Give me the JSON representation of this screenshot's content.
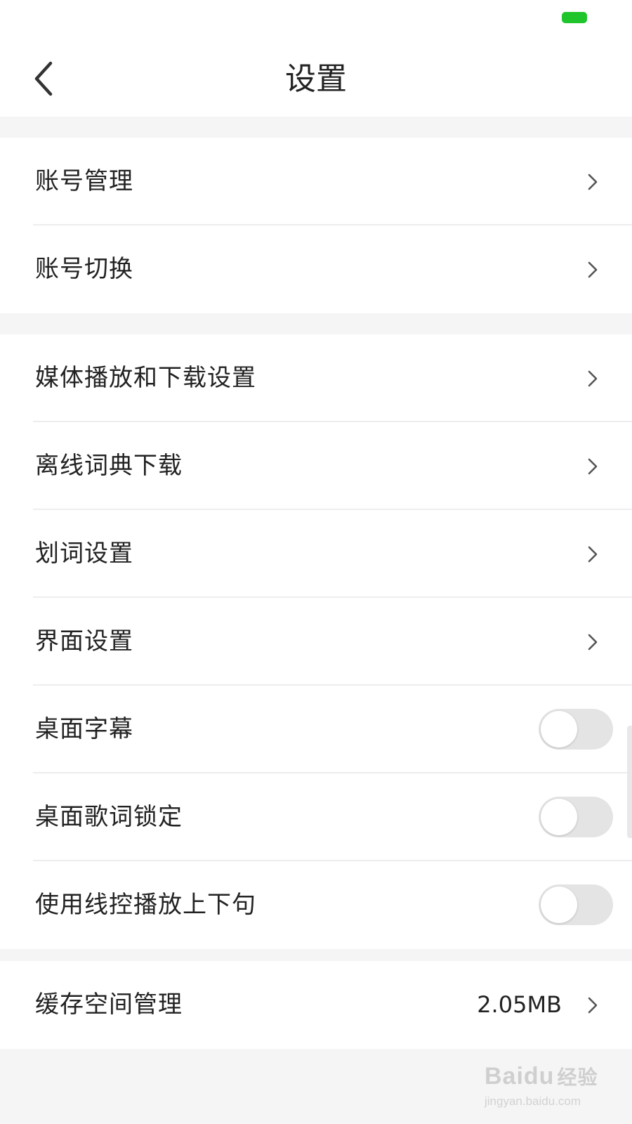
{
  "colors": {
    "accent": "#1fc52b",
    "background": "#f5f5f5",
    "surface": "#ffffff",
    "divider": "#ededed",
    "toggle_off": "#e4e4e4",
    "text": "#222222"
  },
  "status_bar": {
    "battery_icon": "battery-indicator-icon"
  },
  "header": {
    "back_icon": "chevron-left-icon",
    "title": "设置"
  },
  "account_group": {
    "items": [
      {
        "label": "账号管理",
        "control": "chevron"
      },
      {
        "label": "账号切换",
        "control": "chevron"
      }
    ]
  },
  "settings_group": {
    "items": [
      {
        "label": "媒体播放和下载设置",
        "control": "chevron"
      },
      {
        "label": "离线词典下载",
        "control": "chevron"
      },
      {
        "label": "划词设置",
        "control": "chevron"
      },
      {
        "label": "界面设置",
        "control": "chevron"
      },
      {
        "label": "桌面字幕",
        "control": "toggle",
        "enabled": false
      },
      {
        "label": "桌面歌词锁定",
        "control": "toggle",
        "enabled": false
      },
      {
        "label": "使用线控播放上下句",
        "control": "toggle",
        "enabled": false
      }
    ]
  },
  "storage_group": {
    "items": [
      {
        "label": "缓存空间管理",
        "value": "2.05MB",
        "control": "chevron"
      }
    ]
  },
  "watermark": {
    "logo": "Baidu",
    "logo_cn": "经验",
    "url": "jingyan.baidu.com"
  }
}
